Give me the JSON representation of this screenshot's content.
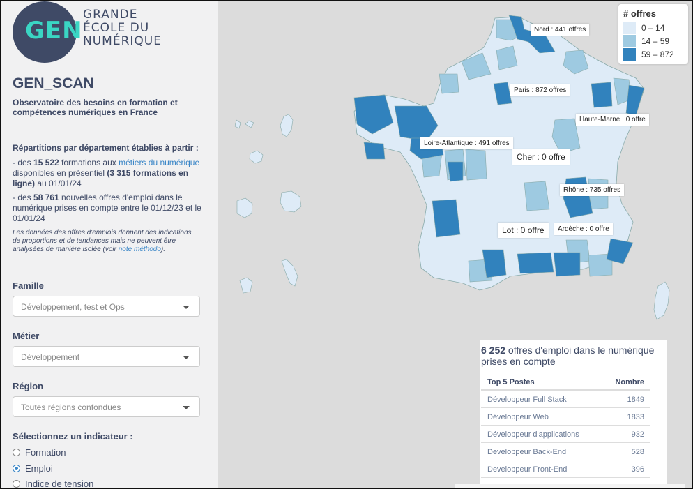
{
  "brand": {
    "logo_text": "GEN",
    "name_lines": [
      "GRANDE",
      "ÉCOLE DU",
      "NUMÉRIQUE"
    ],
    "colors": {
      "navy": "#3f4a66",
      "teal": "#3ad5c3",
      "link": "#3a86c7"
    }
  },
  "sidebar": {
    "title": "GEN_SCAN",
    "subtitle": "Observatoire des besoins en formation et compétences numériques en France",
    "intro": "Répartitions par département établies à partir :",
    "bullet1": {
      "prefix": "- des ",
      "count": "15 522",
      "mid": " formations aux ",
      "link": "métiers du numérique",
      "rest": " disponibles en présentiel ",
      "online": "(3 315 formations en ligne)",
      "date": " au 01/01/24"
    },
    "bullet2": {
      "prefix": "- des ",
      "count": "58 761",
      "rest": " nouvelles offres d'emploi dans le numérique prises en compte entre le 01/12/23 et le 01/01/24"
    },
    "note": {
      "text": "Les données des offres d'emplois donnent des indications de proportions et de tendances mais ne peuvent être analysées de manière isolée (voir ",
      "link": "note méthodo",
      "end": ")."
    },
    "famille": {
      "label": "Famille",
      "value": "Développement, test et Ops"
    },
    "metier": {
      "label": "Métier",
      "value": "Développement"
    },
    "region": {
      "label": "Région",
      "value": "Toutes régions confondues"
    },
    "indicator": {
      "label": "Sélectionnez un indicateur :",
      "options": [
        "Formation",
        "Emploi",
        "Indice de tension"
      ],
      "selected": "Emploi"
    }
  },
  "map": {
    "legend": {
      "title": "# offres",
      "items": [
        {
          "label": "0 – 14",
          "color": "#deebf7"
        },
        {
          "label": "14 – 59",
          "color": "#9ecae1"
        },
        {
          "label": "59 – 872",
          "color": "#3182bd"
        }
      ]
    },
    "tooltips": [
      "Nord : 441 offres",
      "Paris : 872 offres",
      "Haute-Marne : 0 offre",
      "Loire-Atlantique : 491 offres",
      "Cher : 0 offre",
      "Rhône : 735 offres",
      "Lot : 0 offre",
      "Ardèche : 0 offre"
    ]
  },
  "stats": {
    "count": "6 252",
    "headline": " offres d'emploi dans le numérique prises en compte",
    "table": {
      "col1": "Top 5 Postes",
      "col2": "Nombre",
      "rows": [
        {
          "poste": "Développeur Full Stack",
          "nombre": "1849"
        },
        {
          "poste": "Développeur Web",
          "nombre": "1833"
        },
        {
          "poste": "Développeur d'applications",
          "nombre": "932"
        },
        {
          "poste": "Developpeur Back-End",
          "nombre": "528"
        },
        {
          "poste": "Developpeur Front-End",
          "nombre": "396"
        }
      ]
    }
  }
}
